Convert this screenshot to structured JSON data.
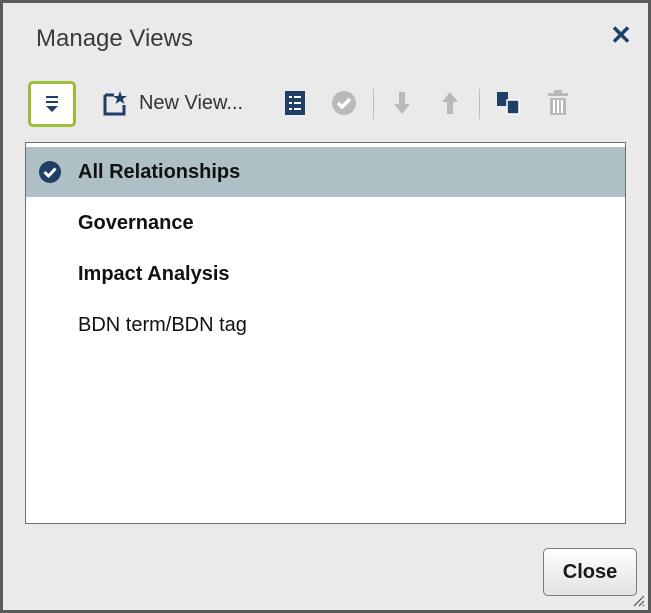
{
  "dialog": {
    "title": "Manage Views",
    "close_button_label": "Close"
  },
  "toolbar": {
    "new_view_label": "New View...",
    "icons": [
      "filter-icon",
      "new-view-icon",
      "properties-icon",
      "set-default-icon",
      "move-down-icon",
      "move-up-icon",
      "copy-icon",
      "delete-icon"
    ]
  },
  "views": {
    "items": [
      {
        "label": "All Relationships",
        "selected": true,
        "bold": true
      },
      {
        "label": "Governance",
        "selected": false,
        "bold": true
      },
      {
        "label": "Impact Analysis",
        "selected": false,
        "bold": true
      },
      {
        "label": "BDN term/BDN tag",
        "selected": false,
        "bold": false
      }
    ]
  },
  "colors": {
    "accent_focus": "#9bbd3a",
    "selection": "#aec0c6",
    "icon_blue": "#1f3f66",
    "disabled": "#b9b9b9"
  }
}
